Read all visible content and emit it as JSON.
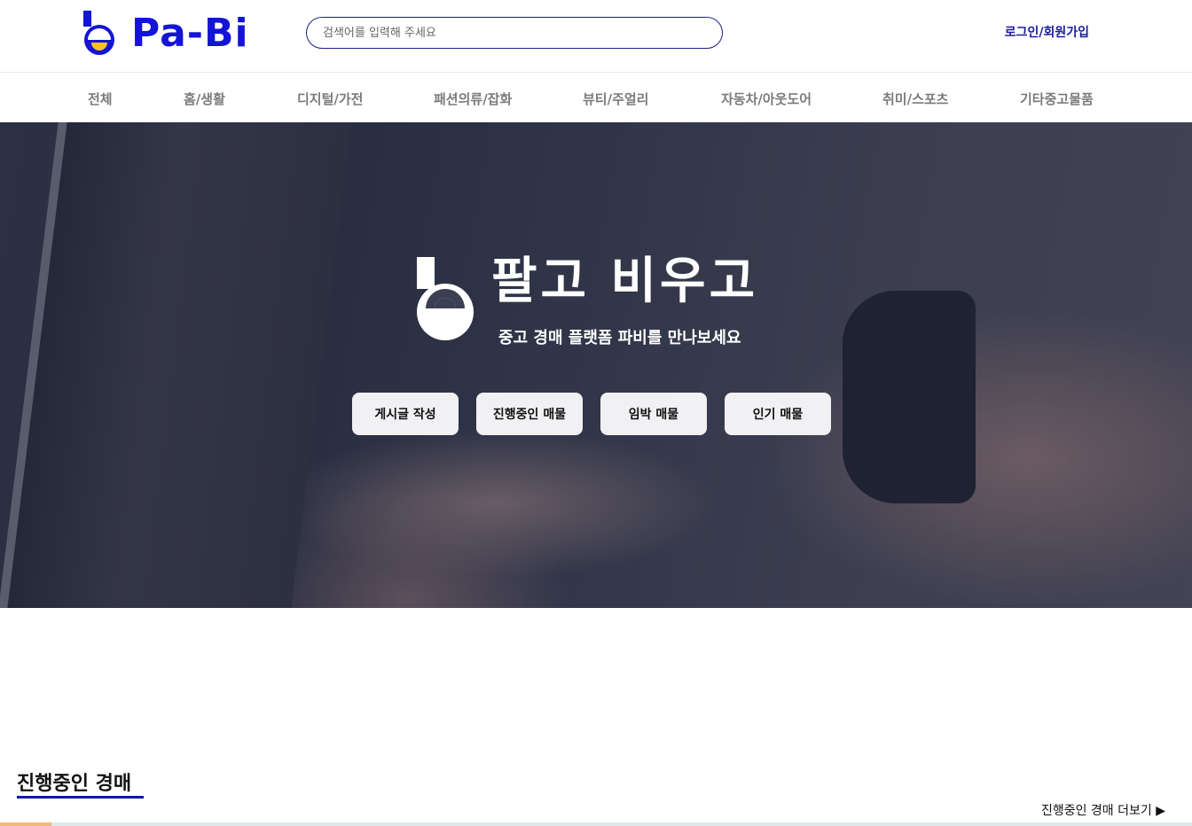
{
  "header": {
    "logo_text": "Pa-Bi",
    "search_placeholder": "검색어를 입력해 주세요",
    "login_label": "로그인/회원가입"
  },
  "categories": [
    "전체",
    "홈/생활",
    "디지털/가전",
    "패션의류/잡화",
    "뷰티/주얼리",
    "자동차/아웃도어",
    "취미/스포츠",
    "기타중고물품"
  ],
  "hero": {
    "title": "팔고 비우고",
    "subtitle": "중고 경매 플랫폼 파비를 만나보세요",
    "buttons": [
      "게시글 작성",
      "진행중인 매물",
      "임박 매물",
      "인기 매물"
    ]
  },
  "section": {
    "title": "진행중인 경매",
    "more_label": "진행중인 경매 더보기 ▶"
  },
  "colors": {
    "brand_blue": "#1414d6",
    "brand_yellow": "#f7c31a",
    "nav_text": "#7b7b7b"
  },
  "icons": {
    "logo_mark": "pabi-logo-icon"
  }
}
